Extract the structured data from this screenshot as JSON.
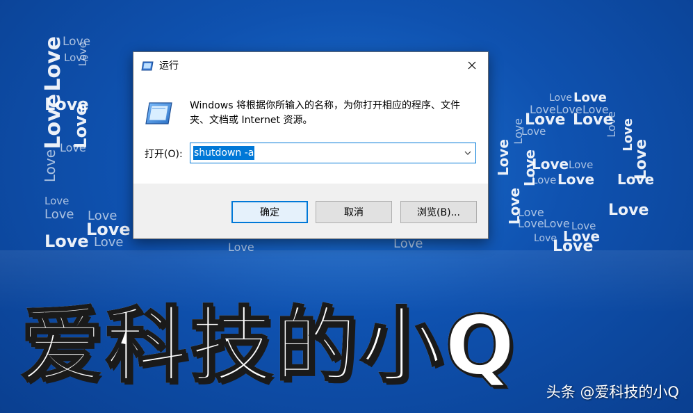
{
  "background": {
    "word": "Love"
  },
  "dialog": {
    "title": "运行",
    "description": "Windows 将根据你所输入的名称，为你打开相应的程序、文件夹、文档或 Internet 资源。",
    "open_label": "打开(O):",
    "input_value": "shutdown -a",
    "buttons": {
      "ok": "确定",
      "cancel": "取消",
      "browse": "浏览(B)..."
    },
    "colors": {
      "accent": "#0078d7"
    }
  },
  "overlay": {
    "title_chars": [
      "爱",
      "科",
      "技",
      "的",
      "小",
      "Q"
    ],
    "watermark": "头条 @爱科技的小Q"
  }
}
